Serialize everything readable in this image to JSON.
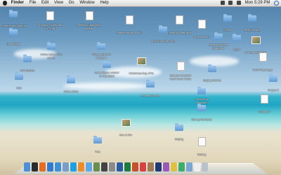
{
  "menubar": {
    "app_name": "Finder",
    "menus": [
      "File",
      "Edit",
      "View",
      "Go",
      "Window",
      "Help"
    ],
    "clock": "Mon 5:29 PM"
  },
  "desktop": {
    "items": [
      {
        "label": "Pictures and Videos",
        "icon": "folder-icon"
      },
      {
        "label": "Anthony Tu resume v3.2.pdf",
        "icon": "doc-icon"
      },
      {
        "label": "Beijing Today style guide",
        "icon": "doc-icon"
      },
      {
        "label": "Passwords and such",
        "icon": "doc-icon"
      },
      {
        "label": "MISCELLANEOUS",
        "icon": "folder-icon"
      },
      {
        "label": "Facebook statuses",
        "icon": "doc-icon"
      },
      {
        "label": "Finances.xls",
        "icon": "doc-icon"
      },
      {
        "label": "CHINA",
        "icon": "folder-icon"
      },
      {
        "label": "Best pictures",
        "icon": "folder-icon"
      },
      {
        "label": "Beijing Ultimate photodisc",
        "icon": "folder-icon"
      },
      {
        "label": "ICSM",
        "icon": "folder-icon"
      },
      {
        "label": "Screen shot 2010",
        "icon": "image-icon"
      },
      {
        "label": "Downloads",
        "icon": "folder-icon"
      },
      {
        "label": "China today DVD series",
        "icon": "folder-icon"
      },
      {
        "label": "VAC prints and headers",
        "icon": "folder-icon"
      },
      {
        "label": "PICTURES",
        "icon": "folder-icon"
      },
      {
        "label": "Christmas Day JPG",
        "icon": "image-icon"
      },
      {
        "label": "Cuts videos related to Tao 2010",
        "icon": "folder-icon"
      },
      {
        "label": "Sample research Ken's Next Tickle",
        "icon": "doc-icon"
      },
      {
        "label": "Beijing Stories",
        "icon": "folder-icon"
      },
      {
        "label": "DVD Player.app",
        "icon": "doc-icon"
      },
      {
        "label": "CDs",
        "icon": "folder-icon"
      },
      {
        "label": "China 2010",
        "icon": "folder-icon"
      },
      {
        "label": "Project 2",
        "icon": "folder-icon"
      },
      {
        "label": "Research Files",
        "icon": "folder-icon"
      },
      {
        "label": "China Duty Research",
        "icon": "folder-icon"
      },
      {
        "label": "Untitled 2",
        "icon": "doc-icon"
      },
      {
        "label": "Money Abstracts",
        "icon": "folder-icon"
      },
      {
        "label": "Eva & Mix",
        "icon": "image-icon"
      },
      {
        "label": "Beijing",
        "icon": "folder-icon"
      },
      {
        "label": "Writing",
        "icon": "doc-icon"
      },
      {
        "label": "Tree",
        "icon": "folder-icon"
      }
    ]
  },
  "dock": {
    "apps": [
      {
        "name": "finder-icon",
        "color": "#4a90d9"
      },
      {
        "name": "dashboard-icon",
        "color": "#2b2b2b"
      },
      {
        "name": "firefox-icon",
        "color": "#e66b1f"
      },
      {
        "name": "globe-icon",
        "color": "#2e7bd1"
      },
      {
        "name": "safari-icon",
        "color": "#3d8fd6"
      },
      {
        "name": "mail-icon",
        "color": "#7b9cc5"
      },
      {
        "name": "skype-icon",
        "color": "#1ba1e2"
      },
      {
        "name": "vlc-icon",
        "color": "#f08a24"
      },
      {
        "name": "itunes-icon",
        "color": "#5ea7e8"
      },
      {
        "name": "iphoto-icon",
        "color": "#6b8e4e"
      },
      {
        "name": "imovie-icon",
        "color": "#444444"
      },
      {
        "name": "system-preferences-icon",
        "color": "#8a8a8a"
      },
      {
        "name": "word-icon",
        "color": "#2c5aa0"
      },
      {
        "name": "excel-icon",
        "color": "#1f7a3e"
      },
      {
        "name": "powerpoint-icon",
        "color": "#c5502a"
      },
      {
        "name": "calendar-icon",
        "color": "#d94040"
      },
      {
        "name": "address-book-icon",
        "color": "#a07a50"
      },
      {
        "name": "photoshop-icon",
        "color": "#1f3b73"
      },
      {
        "name": "app-icon",
        "color": "#9b59b6"
      },
      {
        "name": "app-icon",
        "color": "#e0c040"
      },
      {
        "name": "app-icon",
        "color": "#3cae6a"
      },
      {
        "name": "downloads-stack-icon",
        "color": "#7aa6d4"
      },
      {
        "name": "documents-stack-icon",
        "color": "#eeeeee"
      },
      {
        "name": "trash-icon",
        "color": "#b9c2cc"
      }
    ]
  }
}
